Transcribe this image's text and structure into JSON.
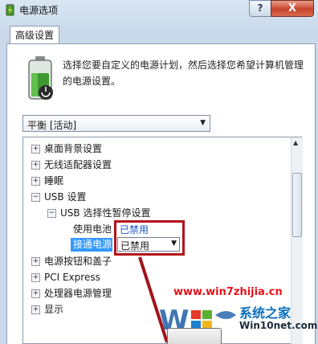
{
  "window": {
    "title": "电源选项",
    "help_label": "?",
    "close_label": "X"
  },
  "tab": {
    "label": "高级设置"
  },
  "description": "选择您要自定义的电源计划，然后选择您希望计算机管理的电源设置。",
  "plan": {
    "selected": "平衡 [活动]"
  },
  "tree": {
    "items": [
      {
        "label": "桌面背景设置",
        "toggle": "+"
      },
      {
        "label": "无线适配器设置",
        "toggle": "+"
      },
      {
        "label": "睡眠",
        "toggle": "+"
      },
      {
        "label": "USB 设置",
        "toggle": "−"
      },
      {
        "label": "USB 选择性暂停设置",
        "toggle": "−"
      },
      {
        "label": "使用电池",
        "value": "已禁用"
      },
      {
        "label": "接通电源",
        "value": "已禁用"
      },
      {
        "label": "电源按钮和盖子",
        "toggle": "+"
      },
      {
        "label": "PCI Express",
        "toggle": "+"
      },
      {
        "label": "处理器电源管理",
        "toggle": "+"
      },
      {
        "label": "显示",
        "toggle": "+"
      }
    ]
  },
  "watermark": {
    "url": "www.win7zhijia.cn",
    "brand": "系统之家",
    "site": "Win10net.com"
  },
  "colors": {
    "highlight_border": "#b3131a",
    "link": "#1a58c7",
    "selection": "#3399ff"
  }
}
